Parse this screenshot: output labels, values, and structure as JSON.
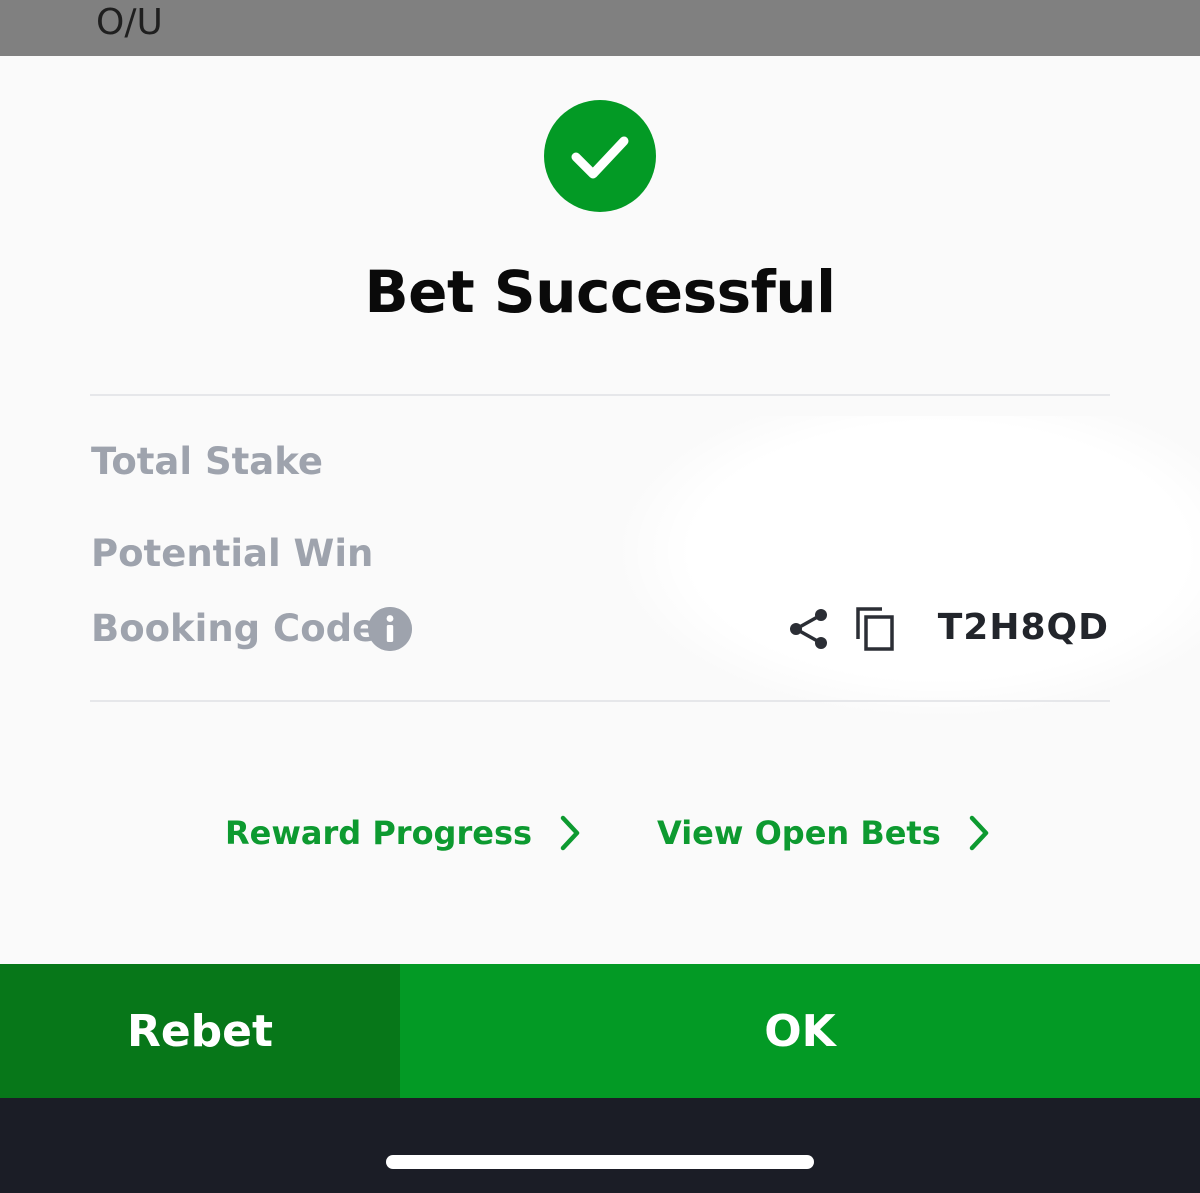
{
  "top_bar": {
    "label": "O/U"
  },
  "status": {
    "title": "Bet Successful",
    "icon": "check-circle-icon"
  },
  "summary": {
    "total_stake_label": "Total Stake",
    "potential_win_label": "Potential Win",
    "booking_code_label": "Booking Code",
    "booking_code": "T2H8QD"
  },
  "links": {
    "reward_progress": "Reward Progress",
    "view_open_bets": "View Open Bets"
  },
  "actions": {
    "rebet_label": "Rebet",
    "ok_label": "OK"
  },
  "colors": {
    "accent_green": "#039a25",
    "rebet_green": "#077719",
    "link_green": "#0d9a30",
    "label_gray": "#9ea3ad",
    "bottom_bar": "#1b1d26"
  }
}
